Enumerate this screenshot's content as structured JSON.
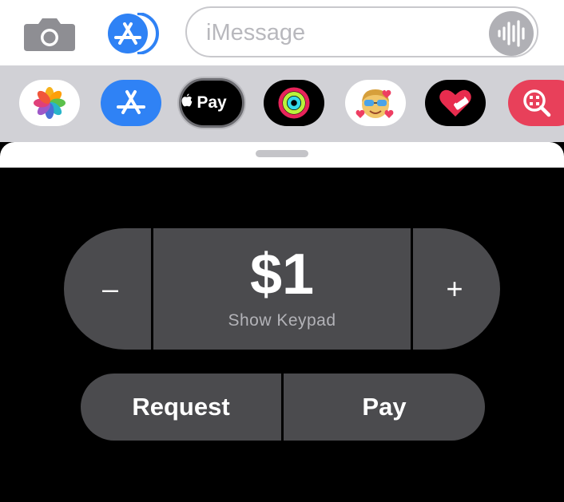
{
  "compose_bar": {
    "camera_icon": "camera-icon",
    "appstore_icon": "app-store-icon",
    "message_placeholder": "iMessage",
    "audio_icon": "audio-waveform-icon"
  },
  "app_drawer": {
    "apps": [
      {
        "name": "Photos",
        "icon": "photos-icon"
      },
      {
        "name": "App Store",
        "icon": "app-store-icon"
      },
      {
        "name": "Apple Pay",
        "icon": "apple-pay-icon",
        "label": "Pay",
        "selected": true
      },
      {
        "name": "Activity",
        "icon": "activity-rings-icon"
      },
      {
        "name": "Memoji",
        "icon": "memoji-icon"
      },
      {
        "name": "Digital Touch",
        "icon": "digital-touch-heart-icon"
      },
      {
        "name": "Images Search",
        "icon": "image-search-icon"
      }
    ]
  },
  "apple_pay": {
    "minus_label": "–",
    "amount": "$1",
    "keypad_label": "Show Keypad",
    "plus_label": "+",
    "request_label": "Request",
    "pay_label": "Pay"
  },
  "colors": {
    "panel_background": "#000000",
    "button_fill": "#4b4b4e",
    "drawer_background": "#d1d1d6",
    "appstore_blue": "#2f82f5",
    "search_red": "#e8405a"
  }
}
